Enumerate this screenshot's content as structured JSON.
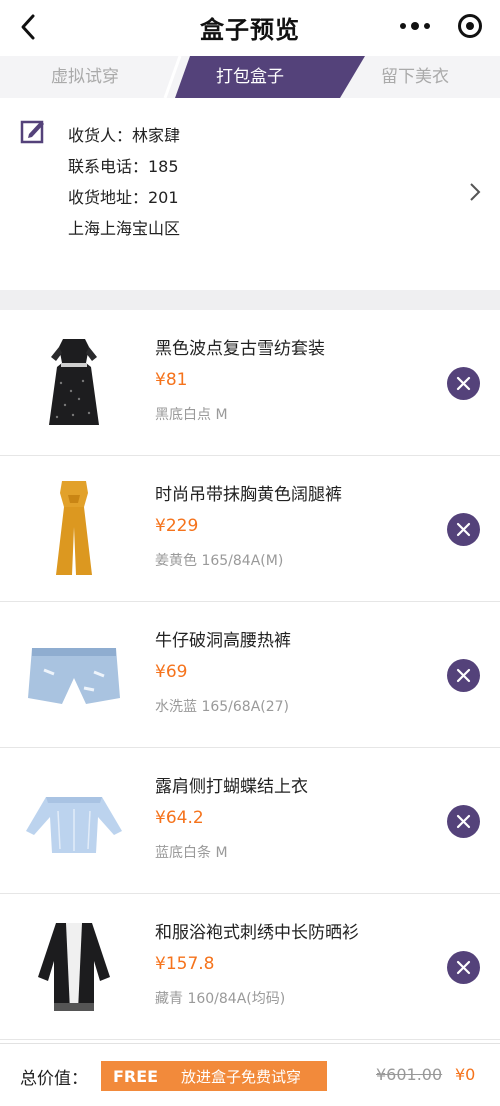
{
  "navbar": {
    "title": "盒子预览"
  },
  "tabs": [
    {
      "label": "虚拟试穿",
      "active": false
    },
    {
      "label": "打包盒子",
      "active": true
    },
    {
      "label": "留下美衣",
      "active": false
    }
  ],
  "address": {
    "receiver": "收货人：林家肆",
    "phone": "联系电话：185",
    "address_line1": "收货地址：201",
    "address_line2": "上海上海宝山区"
  },
  "items": [
    {
      "name": "黑色波点复古雪纺套装",
      "price": "¥81",
      "spec": "黑底白点 M",
      "icon": "black-polka-dot-dress-icon"
    },
    {
      "name": "时尚吊带抹胸黄色阔腿裤",
      "price": "¥229",
      "spec": "姜黄色 165/84A(M)",
      "icon": "yellow-jumpsuit-icon"
    },
    {
      "name": "牛仔破洞高腰热裤",
      "price": "¥69",
      "spec": "水洗蓝 165/68A(27)",
      "icon": "denim-shorts-icon"
    },
    {
      "name": "露肩侧打蝴蝶结上衣",
      "price": "¥64.2",
      "spec": "蓝底白条 M",
      "icon": "off-shoulder-top-icon"
    },
    {
      "name": "和服浴袍式刺绣中长防晒衫",
      "price": "¥157.8",
      "spec": "藏青 160/84A(均码)",
      "icon": "kimono-cardigan-icon"
    }
  ],
  "footer": {
    "total_label": "总价值：",
    "free_word": "FREE",
    "free_text": "放进盒子免费试穿",
    "original_total": "¥601.00",
    "final_total": "¥0"
  },
  "colors": {
    "accent": "#54427a",
    "price": "#f5731c",
    "free_banner": "#f28a3b"
  }
}
